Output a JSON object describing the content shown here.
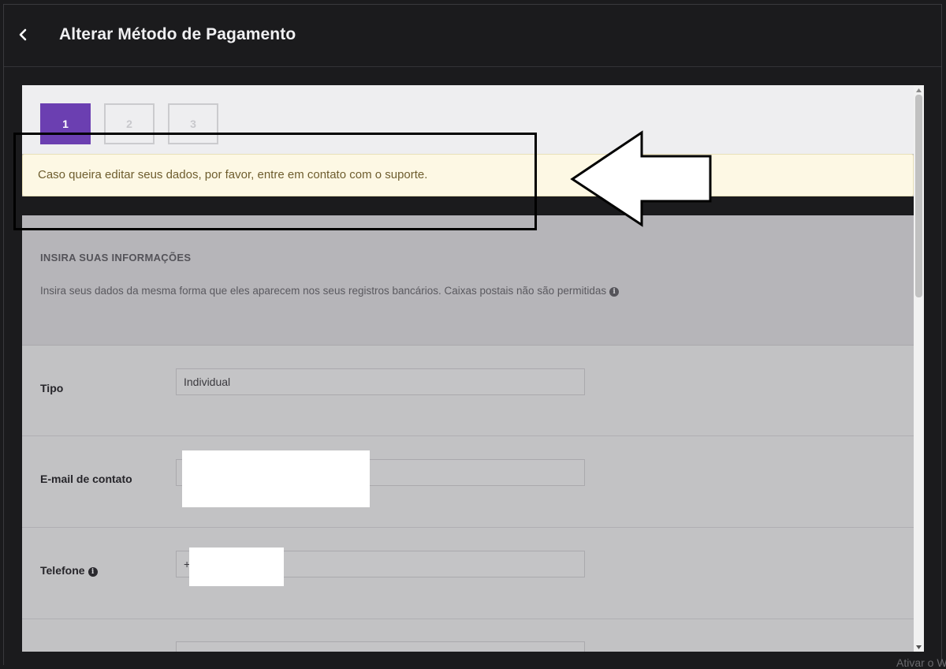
{
  "header": {
    "title": "Alterar Método de Pagamento"
  },
  "steps": [
    {
      "label": "1",
      "state": "active"
    },
    {
      "label": "2",
      "state": "inactive"
    },
    {
      "label": "3",
      "state": "inactive"
    }
  ],
  "notice": {
    "text": "Caso queira editar seus dados, por favor, entre em contato com o suporte."
  },
  "info_section": {
    "title": "INSIRA SUAS INFORMAÇÕES",
    "description": "Insira seus dados da mesma forma que eles aparecem nos seus registros bancários. Caixas postais não são permitidas"
  },
  "form": {
    "type_label": "Tipo",
    "type_value": "Individual",
    "email_label": "E-mail de contato",
    "email_value": "",
    "phone_label": "Telefone",
    "phone_value": "+"
  },
  "watermark": "Ativar o W",
  "colors": {
    "accent": "#6b3fb1",
    "notice_bg": "#fdf8e4",
    "notice_text": "#6e5d2e",
    "background": "#1b1b1d"
  },
  "icons": {
    "back": "chevron-left-icon",
    "info": "info-circle-icon"
  }
}
